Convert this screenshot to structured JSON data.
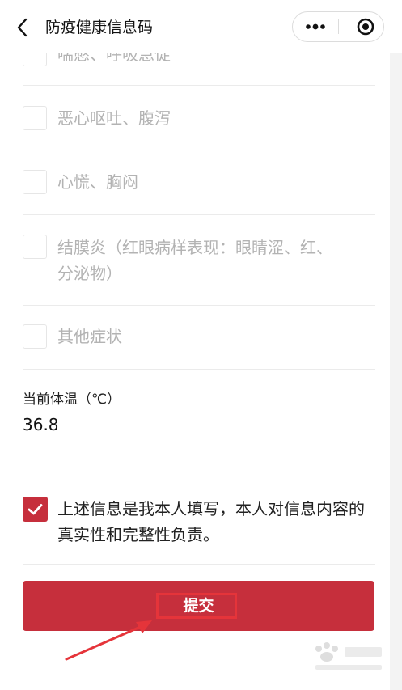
{
  "header": {
    "title": "防疫健康信息码",
    "back_icon": "back-chevron-icon",
    "more_icon": "more-dots-icon",
    "close_icon": "target-close-icon"
  },
  "symptoms": [
    {
      "label": "喘憋、呼吸急促",
      "checked": false
    },
    {
      "label": "恶心呕吐、腹泻",
      "checked": false
    },
    {
      "label": "心慌、胸闷",
      "checked": false
    },
    {
      "label": "结膜炎（红眼病样表现：眼睛涩、红、分泌物）",
      "checked": false
    },
    {
      "label": "其他症状",
      "checked": false
    }
  ],
  "temperature": {
    "label": "当前体温（℃）",
    "value": "36.8"
  },
  "agreement": {
    "text": "上述信息是我本人填写，本人对信息内容的真实性和完整性负责。",
    "checked": true
  },
  "submit": {
    "label": "提交"
  },
  "colors": {
    "accent": "#c62f3c",
    "annotation": "#e5343a",
    "muted_text": "#b3b3b3"
  }
}
